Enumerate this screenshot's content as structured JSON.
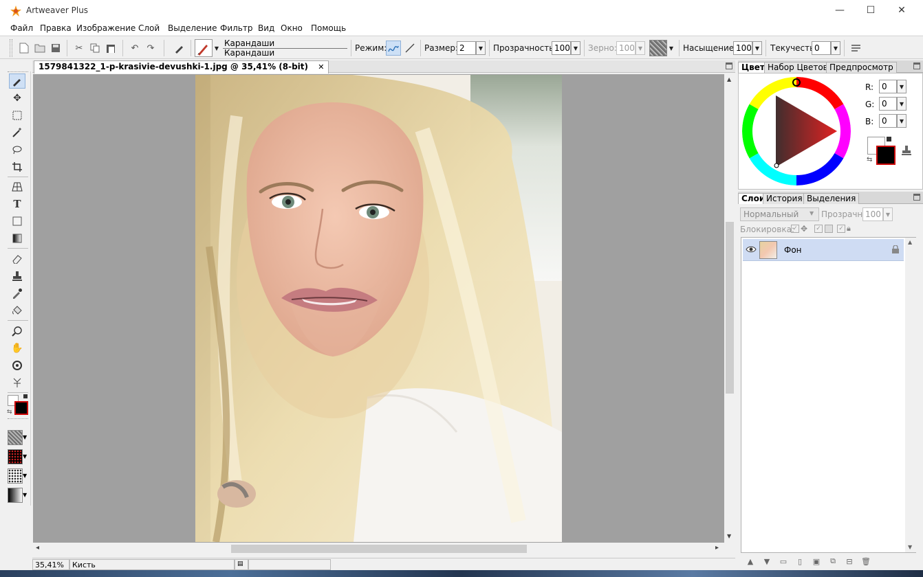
{
  "window": {
    "title": "Artweaver Plus",
    "minimize_glyph": "—",
    "maximize_glyph": "☐",
    "close_glyph": "✕"
  },
  "menu": [
    "Файл",
    "Правка",
    "Изображение",
    "Слой",
    "Выделение",
    "Фильтр",
    "Вид",
    "Окно",
    "Помощь"
  ],
  "toolbar": {
    "brush_category": "Карандаши",
    "brush_variant": "Карандаши",
    "mode_label": "Режим:",
    "size_label": "Размер:",
    "size_value": "2",
    "opacity_label": "Прозрачность:",
    "opacity_value": "100",
    "grain_label": "Зерно:",
    "grain_value": "100",
    "saturation_label": "Насыщение:",
    "saturation_value": "100",
    "fluidity_label": "Текучесть:",
    "fluidity_value": "0"
  },
  "document": {
    "tab_title": "1579841322_1-p-krasivie-devushki-1.jpg @ 35,41% (8-bit)",
    "close_glyph": "✕",
    "zoom": "35,41%",
    "tool_name": "Кисть"
  },
  "color_panel": {
    "tabs": [
      "Цвет",
      "Набор Цветов",
      "Предпросмотр"
    ],
    "active_tab": 0,
    "r_label": "R:",
    "r_value": "0",
    "g_label": "G:",
    "g_value": "0",
    "b_label": "B:",
    "b_value": "0",
    "foreground_color": "#ffffff",
    "background_color": "#000000"
  },
  "layers_panel": {
    "tabs": [
      "Слои",
      "История",
      "Выделения"
    ],
    "active_tab": 0,
    "blend_mode": "Нормальный",
    "opacity_label": "Прозрачн:",
    "opacity_value": "100",
    "lock_label": "Блокировка:",
    "layers": [
      {
        "name": "Фон",
        "visible": true,
        "locked": true,
        "selected": true
      }
    ]
  },
  "colors": {
    "accent": "#cfdcf3",
    "canvas_bg": "#a0a0a0",
    "selection_border": "#8fb1d9"
  },
  "icons": {
    "left_tools": [
      "brush-icon",
      "move-icon",
      "rect-select-icon",
      "magic-wand-icon",
      "lasso-icon",
      "crop-icon",
      "perspective-icon",
      "text-icon",
      "shape-icon",
      "gradient-icon",
      "eraser-icon",
      "stamp-icon",
      "eyedropper-icon",
      "fill-icon",
      "zoom-icon",
      "hand-icon",
      "rotate-icon",
      "warp-icon"
    ]
  }
}
